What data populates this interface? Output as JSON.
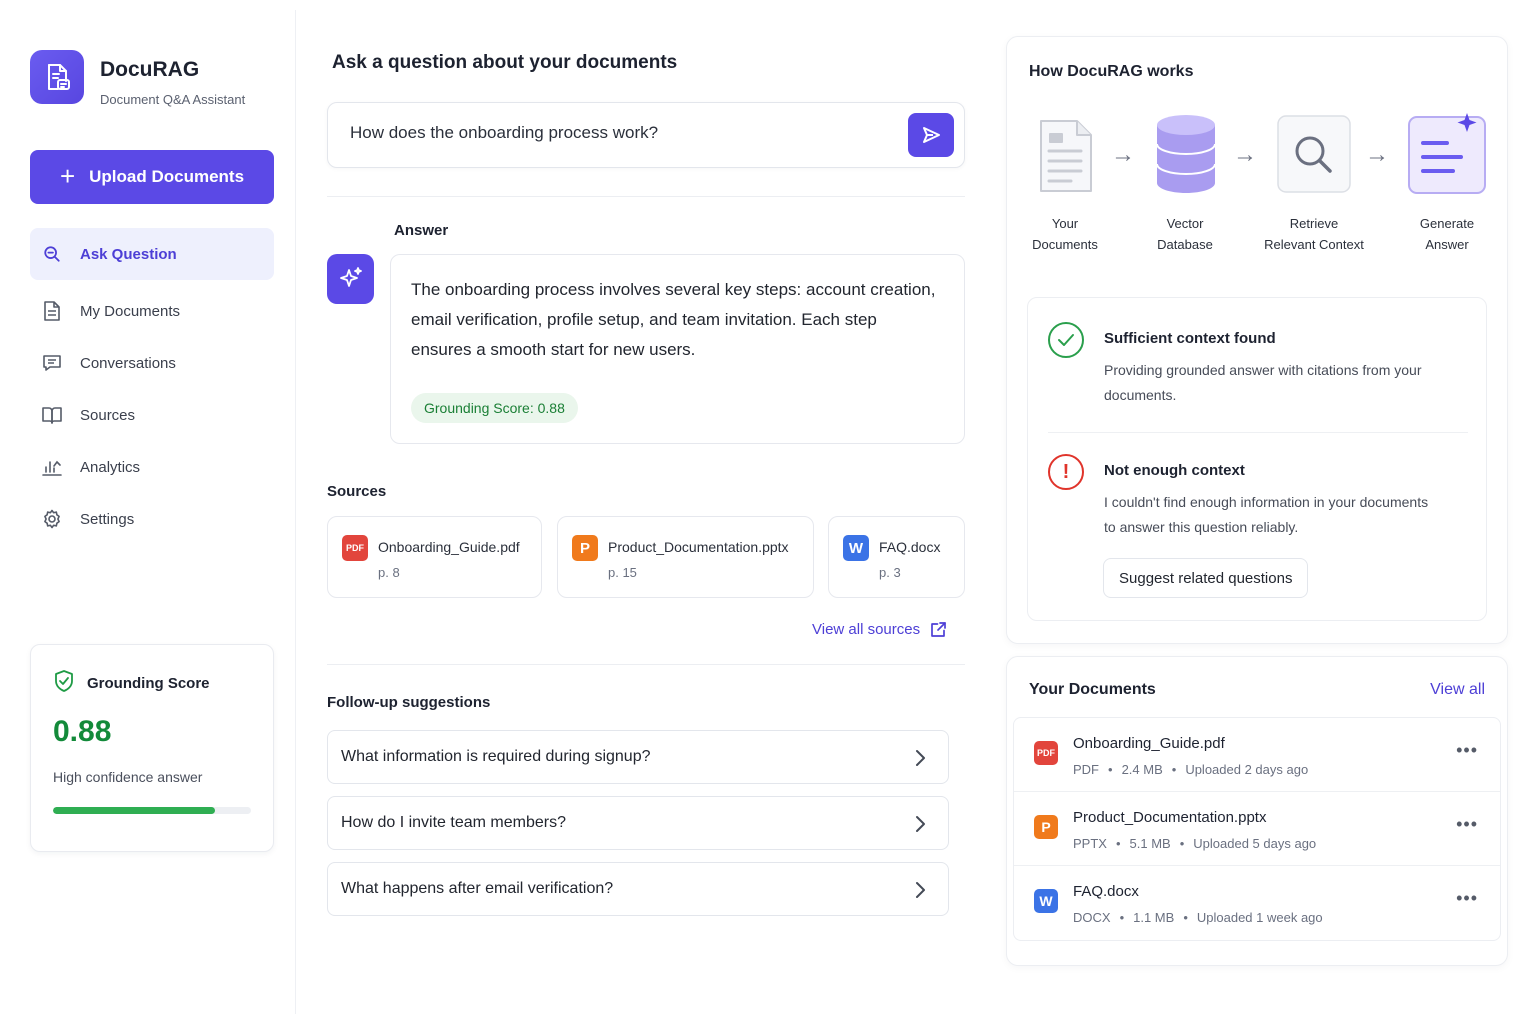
{
  "app": {
    "title": "DocuRAG",
    "subtitle": "Document Q&A Assistant"
  },
  "sidebar": {
    "upload_label": "Upload Documents",
    "items": [
      {
        "label": "Ask Question",
        "icon": "search-icon",
        "active": true
      },
      {
        "label": "My Documents",
        "icon": "document-icon"
      },
      {
        "label": "Conversations",
        "icon": "chat-icon"
      },
      {
        "label": "Sources",
        "icon": "book-icon"
      },
      {
        "label": "Analytics",
        "icon": "chart-icon"
      },
      {
        "label": "Settings",
        "icon": "gear-icon"
      }
    ],
    "score_card": {
      "title": "Grounding Score",
      "value": "0.88",
      "description": "High confidence answer",
      "progress": 0.82
    }
  },
  "main": {
    "title": "Ask a question about your documents",
    "question": "How does the onboarding process work?",
    "answer_label": "Answer",
    "answer_text": "The onboarding process involves several key steps: account creation, email verification, profile setup, and team invitation. Each step ensures a smooth start for new users.",
    "grounding_chip": "Grounding Score: 0.88",
    "sources_label": "Sources",
    "sources": [
      {
        "badge": "PDF",
        "name": "Onboarding_Guide.pdf",
        "page": "p. 8"
      },
      {
        "badge": "P",
        "name": "Product_Documentation.pptx",
        "page": "p. 15"
      },
      {
        "badge": "W",
        "name": "FAQ.docx",
        "page": "p. 3"
      }
    ],
    "view_all_sources": "View all sources",
    "followup_label": "Follow-up suggestions",
    "followups": [
      "What information is required during signup?",
      "How do I invite team members?",
      "What happens after email verification?"
    ]
  },
  "how": {
    "title": "How DocuRAG works",
    "steps": [
      {
        "line1": "Your",
        "line2": "Documents"
      },
      {
        "line1": "Vector",
        "line2": "Database"
      },
      {
        "line1": "Retrieve",
        "line2": "Relevant Context"
      },
      {
        "line1": "Generate",
        "line2": "Answer"
      }
    ],
    "arrow": "→",
    "sufficient": {
      "title": "Sufficient context found",
      "desc": "Providing grounded answer with citations from your documents."
    },
    "insufficient": {
      "title": "Not enough context",
      "desc": "I couldn't find enough information in your documents to answer this question reliably.",
      "button": "Suggest related questions"
    }
  },
  "documents": {
    "title": "Your Documents",
    "view_all": "View all",
    "items": [
      {
        "badge": "PDF",
        "name": "Onboarding_Guide.pdf",
        "type": "PDF",
        "size": "2.4 MB",
        "uploaded": "Uploaded 2 days ago"
      },
      {
        "badge": "P",
        "name": "Product_Documentation.pptx",
        "type": "PPTX",
        "size": "5.1 MB",
        "uploaded": "Uploaded 5 days ago"
      },
      {
        "badge": "W",
        "name": "FAQ.docx",
        "type": "DOCX",
        "size": "1.1 MB",
        "uploaded": "Uploaded 1 week ago"
      }
    ],
    "dot": "•",
    "more": "•••"
  },
  "colors": {
    "accent": "#5b49e6",
    "success": "#138a3a",
    "danger": "#e0342b",
    "pdf": "#e2453c",
    "pptx": "#f07a1c",
    "docx": "#3b73e6"
  }
}
